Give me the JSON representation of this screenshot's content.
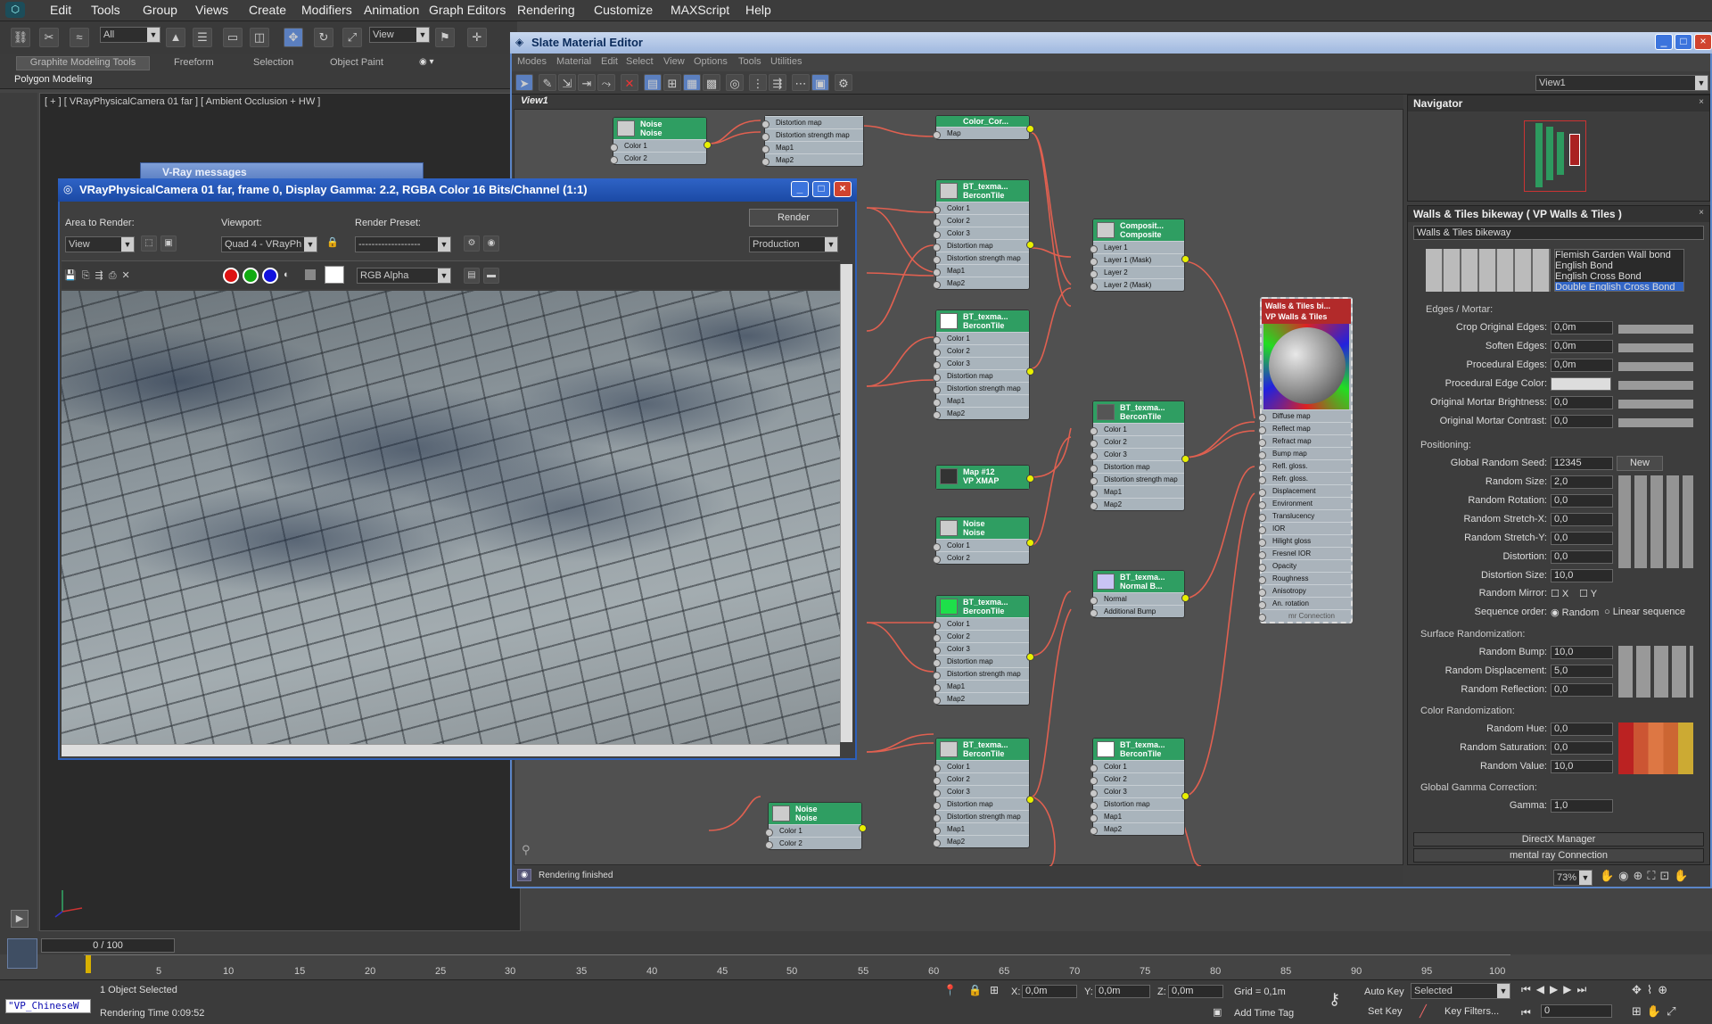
{
  "menu": [
    "Edit",
    "Tools",
    "Group",
    "Views",
    "Create",
    "Modifiers",
    "Animation",
    "Graph Editors",
    "Rendering",
    "Customize",
    "MAXScript",
    "Help"
  ],
  "toolbar": {
    "selection_filter": "All",
    "ref_coord": "View"
  },
  "ribbon": {
    "tabs": [
      "Graphite Modeling Tools",
      "Freeform",
      "Selection",
      "Object Paint"
    ],
    "sub": "Polygon Modeling"
  },
  "viewport_label": "[ + ] [ VRayPhysicalCamera 01 far ] [ Ambient Occlusion + HW ]",
  "vray_messages_title": "V-Ray messages",
  "slate": {
    "title": "Slate Material Editor",
    "menu": [
      "Modes",
      "Material",
      "Edit",
      "Select",
      "View",
      "Options",
      "Tools",
      "Utilities"
    ],
    "view_tab": "View1",
    "view_dropdown": "View1",
    "status": "Rendering finished",
    "zoom": "73%"
  },
  "nodes": {
    "noise": {
      "t1": "Noise",
      "t2": "Noise",
      "r1": "Color 1",
      "r2": "Color 2"
    },
    "dist": {
      "r1": "Distortion map",
      "r2": "Distortion strength map",
      "r3": "Map1",
      "r4": "Map2"
    },
    "colorcor": {
      "t1": "Color_Cor...",
      "r1": "Map"
    },
    "bt": {
      "t1": "BT_texma...",
      "t2": "BerconTile",
      "rows": [
        "Color 1",
        "Color 2",
        "Color 3",
        "Distortion map",
        "Distortion strength map",
        "Map1",
        "Map2"
      ]
    },
    "comp": {
      "t1": "Composit...",
      "t2": "Composite",
      "rows": [
        "Layer 1",
        "Layer 1 (Mask)",
        "Layer 2",
        "Layer 2 (Mask)"
      ]
    },
    "xmap": {
      "t1": "Map #12",
      "t2": "VP XMAP"
    },
    "normal": {
      "t1": "BT_texma...",
      "t2": "Normal B...",
      "rows": [
        "Normal",
        "Additional Bump"
      ]
    },
    "walls": {
      "t1": "Walls & Tiles bi...",
      "t2": "VP Walls & Tiles",
      "rows": [
        "Diffuse map",
        "Reflect map",
        "Refract map",
        "Bump map",
        "Refl. gloss.",
        "Refr. gloss.",
        "Displacement",
        "Environment",
        "Translucency",
        "IOR",
        "Hilight gloss",
        "Fresnel IOR",
        "Opacity",
        "Roughness",
        "Anisotropy",
        "An. rotation",
        "mr Connection"
      ]
    }
  },
  "render_window": {
    "title": "VRayPhysicalCamera 01 far, frame 0, Display Gamma: 2.2, RGBA Color 16 Bits/Channel (1:1)",
    "area_label": "Area to Render:",
    "area_value": "View",
    "viewport_label": "Viewport:",
    "viewport_value": "Quad 4 - VRayPh",
    "preset_label": "Render Preset:",
    "preset_value": "-------------------",
    "render_btn": "Render",
    "production": "Production",
    "channel": "RGB Alpha"
  },
  "navigator": {
    "title": "Navigator"
  },
  "params": {
    "title": "Walls & Tiles bikeway  ( VP Walls & Tiles )",
    "name": "Walls & Tiles bikeway",
    "bonds": [
      "Flemish Garden Wall bond",
      "English Bond",
      "English Cross Bond",
      "Double English Cross Bond"
    ],
    "edges_title": "Edges / Mortar:",
    "edges": [
      [
        "Crop Original Edges:",
        "0,0m"
      ],
      [
        "Soften Edges:",
        "0,0m"
      ],
      [
        "Procedural Edges:",
        "0,0m"
      ]
    ],
    "edge_color": "Procedural Edge Color:",
    "mortar": [
      [
        "Original Mortar Brightness:",
        "0,0"
      ],
      [
        "Original Mortar Contrast:",
        "0,0"
      ]
    ],
    "pos_title": "Positioning:",
    "seed_label": "Global Random Seed:",
    "seed": "12345",
    "new_btn": "New",
    "pos": [
      [
        "Random Size:",
        "2,0"
      ],
      [
        "Random Rotation:",
        "0,0"
      ],
      [
        "Random Stretch-X:",
        "0,0"
      ],
      [
        "Random Stretch-Y:",
        "0,0"
      ],
      [
        "Distortion:",
        "0,0"
      ],
      [
        "Distortion Size:",
        "10,0"
      ]
    ],
    "mirror": "Random Mirror:",
    "mx": "X",
    "my": "Y",
    "seq": "Sequence order:",
    "seq_random": "Random",
    "seq_linear": "Linear sequence",
    "surf_title": "Surface Randomization:",
    "surf": [
      [
        "Random Bump:",
        "10,0"
      ],
      [
        "Random Displacement:",
        "5,0"
      ],
      [
        "Random Reflection:",
        "0,0"
      ]
    ],
    "color_title": "Color Randomization:",
    "color": [
      [
        "Random Hue:",
        "0,0"
      ],
      [
        "Random Saturation:",
        "0,0"
      ],
      [
        "Random Value:",
        "10,0"
      ]
    ],
    "gamma_title": "Global Gamma Correction:",
    "gamma_label": "Gamma:",
    "gamma": "1,0",
    "rollouts": [
      "DirectX Manager",
      "mental ray Connection"
    ]
  },
  "timeline": {
    "frame": "0 / 100",
    "ticks": [
      "5",
      "10",
      "15",
      "20",
      "25",
      "30",
      "35",
      "40",
      "45",
      "50",
      "55",
      "60",
      "65",
      "70",
      "75",
      "80",
      "85",
      "90",
      "95",
      "100"
    ]
  },
  "status": {
    "script": "\"VP_ChineseW",
    "selected": "1 Object Selected",
    "render_time": "Rendering Time  0:09:52",
    "x_label": "X:",
    "x": "0,0m",
    "y_label": "Y:",
    "y": "0,0m",
    "z_label": "Z:",
    "z": "0,0m",
    "grid": "Grid = 0,1m",
    "add_time_tag": "Add Time Tag",
    "auto_key": "Auto Key",
    "set_key": "Set Key",
    "key_mode": "Selected",
    "key_filters": "Key Filters...",
    "frame_val": "0"
  }
}
